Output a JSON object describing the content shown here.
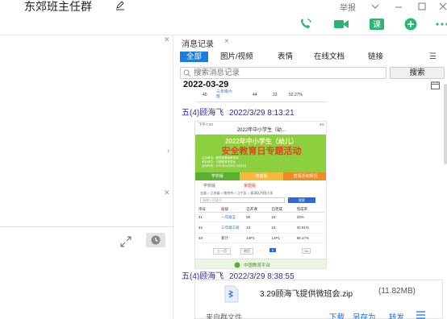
{
  "window": {
    "title": "东郊班主任群",
    "report_label": "举报"
  },
  "colors": {
    "accent": "#1a7be0",
    "call_green": "#2bb673",
    "sender_blue": "#2f2f9e",
    "banner_green": "#8ccf3f",
    "banner_text": "#e2421d"
  },
  "history": {
    "tab_label": "消息记录",
    "tab_close": "×",
    "filters": [
      "全部",
      "图片/视频",
      "表情",
      "在线文档",
      "链接"
    ],
    "search_placeholder": "搜索消息记录",
    "search_button": "搜索",
    "date": "2022-03-29",
    "top_row": [
      "40",
      "三年级六班",
      "44",
      "23",
      "52.27%"
    ],
    "messages": [
      {
        "sender": "五(4)顾海飞",
        "time": "2022/3/29 8:13:21"
      },
      {
        "sender": "五(4)顾海飞",
        "time": "2022/3/29 8:38:55"
      }
    ],
    "file": {
      "name": "3.29顾海飞提供微班会.zip",
      "size": "(11.82MB)",
      "source": "来自群文件",
      "actions": [
        "下载",
        "另存为",
        "转发"
      ]
    }
  },
  "shot": {
    "status_left": "下午7:43",
    "status_right": "4G",
    "title": "2022年中小学生（幼...",
    "banner_line1": "2022年中小学生（幼儿）",
    "banner_line2": "安全教育日专题活动",
    "banner_info": [
      "主办单位：教育部基础教育司",
      "承办单位：中国教育电视台",
      "活动时间：2022年3月28日-4月30日"
    ],
    "menu": [
      "学校版",
      "家庭版",
      "查看活动情况"
    ],
    "tabs": [
      "学校版",
      "家庭版"
    ],
    "breadcrumb": "全部 > 江苏省 > 南京市 > 江宁区 > 高淳区丹阳小学",
    "select_placeholder": "请输入班级号",
    "search_btn": "搜索",
    "table_headers": [
      "序号",
      "班级",
      "已开课",
      "已完成",
      "完成率"
    ],
    "table_rows": [
      [
        "41",
        "一年级五",
        "60",
        "18",
        "33%"
      ],
      [
        "42",
        "三年级三班",
        "44",
        "18",
        "40.91%"
      ],
      [
        "43",
        "新计",
        "14P1",
        "14P1",
        "88.17%"
      ]
    ],
    "pager": [
      "上一页",
      "首页",
      "...",
      "5",
      "Go"
    ],
    "footer": "中国教育平台"
  }
}
